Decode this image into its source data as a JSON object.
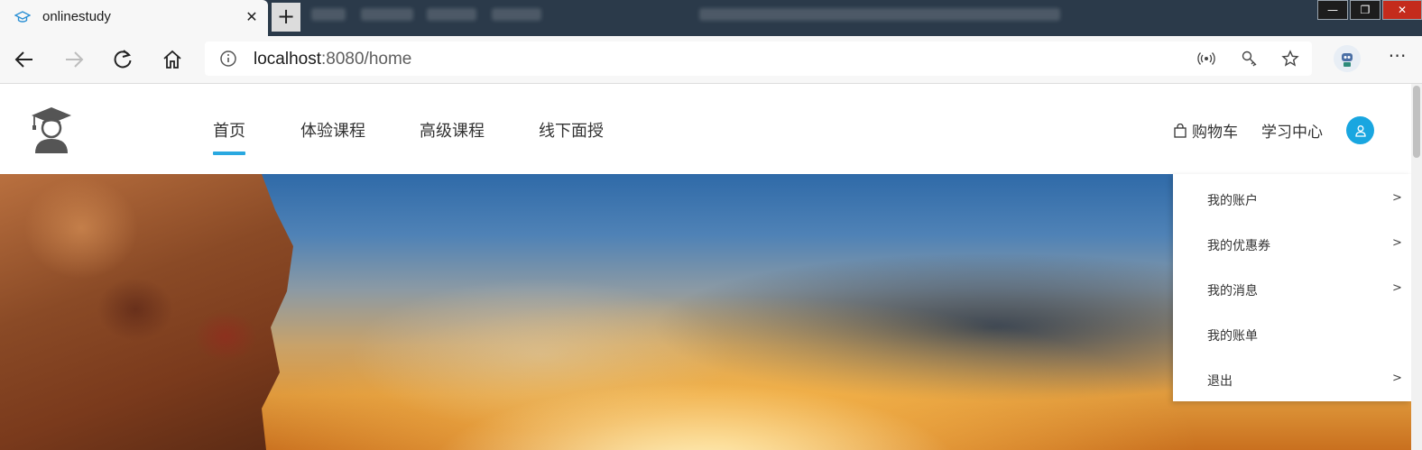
{
  "browser": {
    "tab_title": "onlinestudy",
    "tab_close": "✕",
    "new_tab": "+",
    "url_host": "localhost",
    "url_path": ":8080/home",
    "window_controls": [
      "—",
      "❐",
      "✕"
    ],
    "more_menu": "⋯"
  },
  "site": {
    "nav": [
      {
        "label": "首页",
        "active": true
      },
      {
        "label": "体验课程",
        "active": false
      },
      {
        "label": "高级课程",
        "active": false
      },
      {
        "label": "线下面授",
        "active": false
      }
    ],
    "cart_label": "购物车",
    "study_center_label": "学习中心",
    "accent_color": "#29a8e0"
  },
  "user_menu": [
    {
      "label": "我的账户",
      "arrow": ">"
    },
    {
      "label": "我的优惠券",
      "arrow": ">"
    },
    {
      "label": "我的消息",
      "arrow": ">"
    },
    {
      "label": "我的账单",
      "arrow": ""
    },
    {
      "label": "退出",
      "arrow": ">"
    }
  ]
}
